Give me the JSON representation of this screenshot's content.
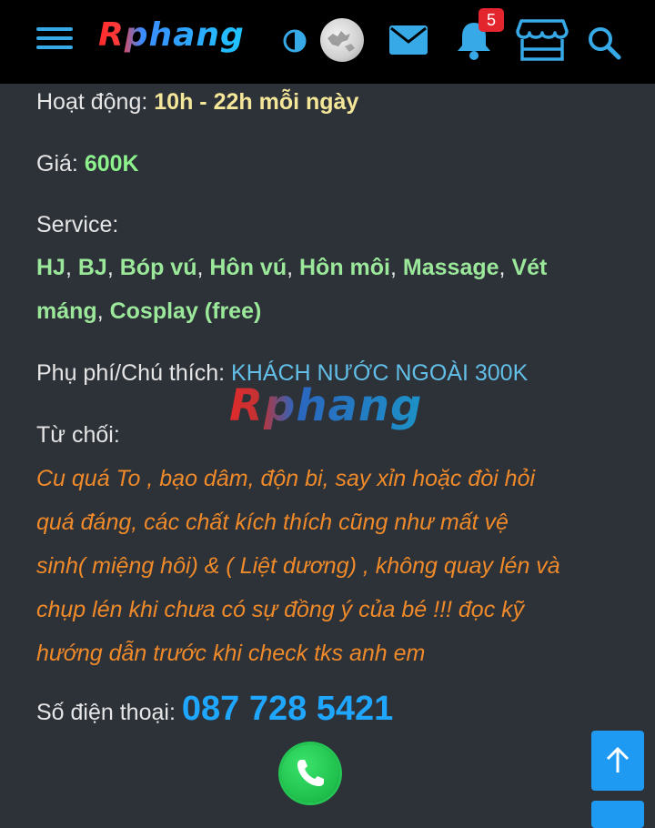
{
  "header": {
    "brand": "Rphang",
    "notification_count": "5",
    "icons": {
      "menu": "hamburger-menu-icon",
      "theme": "theme-toggle-icon",
      "mail": "mail-icon",
      "bell": "bell-icon",
      "store": "store-icon",
      "search": "search-icon"
    },
    "accent_color": "#37a9e6"
  },
  "content": {
    "hours": {
      "label": "Hoạt động:",
      "value": "10h - 22h mỗi ngày"
    },
    "price": {
      "label": "Giá:",
      "value": "600K"
    },
    "service": {
      "label": "Service:",
      "items": [
        "HJ",
        "BJ",
        "Bóp vú",
        "Hôn vú",
        "Hôn môi",
        "Massage",
        "Vét máng",
        "Cosplay (free)"
      ]
    },
    "fee": {
      "label": "Phụ phí/Chú thích:",
      "value": "KHÁCH NƯỚC NGOÀI 300K"
    },
    "refuse": {
      "label": "Từ chối:",
      "lines": [
        "Cu quá To , bạo dâm, độn bi, say xỉn hoặc đòi hỏi",
        "quá đáng, các chất kích thích cũng như mất vệ",
        "sinh( miệng hôi) & ( Liệt dương) , không quay lén và",
        "chụp lén khi chưa có sự đồng ý của bé !!! đọc kỹ",
        "hướng dẫn trước khi check tks anh em"
      ]
    },
    "phone": {
      "label": "Số điện thoại:",
      "value": "087 728 5421"
    }
  },
  "watermark": "Rphang",
  "colors": {
    "background": "#2d3138",
    "label": "#e6e6e6",
    "hours_value": "#f5e79a",
    "green_value": "#8df28d",
    "fee_value": "#62bfe8",
    "refuse_text": "#ef8a2a",
    "phone_value": "#1fa6ff",
    "call_button": "#1fbf4c",
    "scroll_top_button": "#1e9af2"
  }
}
